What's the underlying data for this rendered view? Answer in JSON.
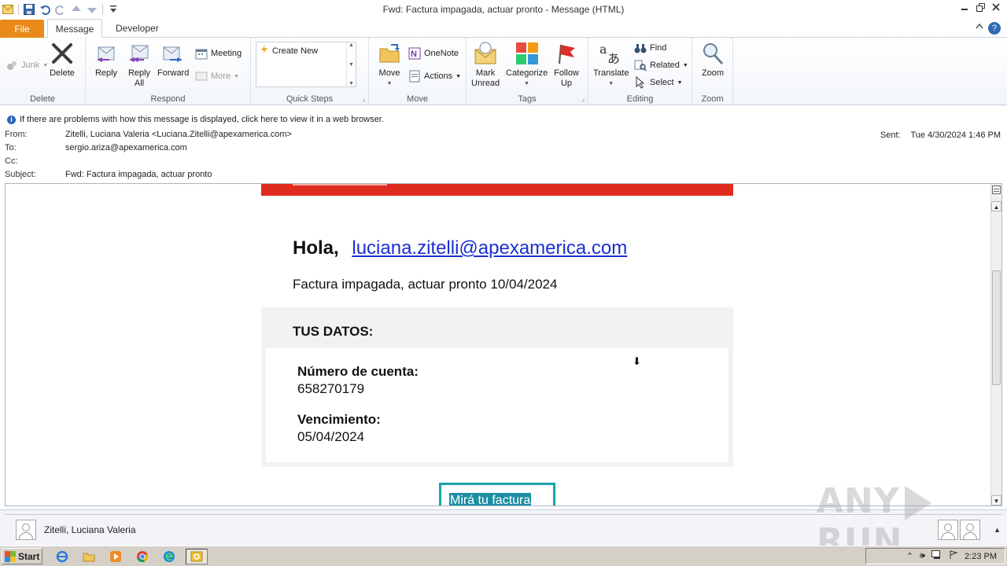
{
  "window": {
    "title": "Fwd: Factura impagada, actuar pronto  -  Message (HTML)"
  },
  "ribbon_tabs": {
    "file": "File",
    "message": "Message",
    "developer": "Developer"
  },
  "ribbon": {
    "delete_group": {
      "label": "Delete",
      "junk": "Junk",
      "delete": "Delete"
    },
    "respond_group": {
      "label": "Respond",
      "reply": "Reply",
      "reply_all_1": "Reply",
      "reply_all_2": "All",
      "forward": "Forward",
      "meeting": "Meeting",
      "more": "More"
    },
    "quick_steps_group": {
      "label": "Quick Steps",
      "create_new": "Create New"
    },
    "move_group": {
      "label": "Move",
      "move": "Move",
      "onenote": "OneNote",
      "actions": "Actions"
    },
    "tags_group": {
      "label": "Tags",
      "mark_unread_1": "Mark",
      "mark_unread_2": "Unread",
      "categorize": "Categorize",
      "follow_up_1": "Follow",
      "follow_up_2": "Up"
    },
    "editing_group": {
      "label": "Editing",
      "translate": "Translate",
      "find": "Find",
      "related": "Related",
      "select": "Select"
    },
    "zoom_group": {
      "label": "Zoom",
      "zoom": "Zoom"
    }
  },
  "infobar": {
    "text": "If there are problems with how this message is displayed, click here to view it in a web browser."
  },
  "header": {
    "from_label": "From:",
    "from_value": "Zitelli, Luciana Valeria <Luciana.Zitelli@apexamerica.com>",
    "to_label": "To:",
    "to_value": "sergio.ariza@apexamerica.com",
    "cc_label": "Cc:",
    "cc_value": "",
    "subject_label": "Subject:",
    "subject_value": "Fwd: Factura impagada, actuar pronto",
    "sent_label": "Sent:",
    "sent_value": "Tue 4/30/2024 1:46 PM"
  },
  "email_body": {
    "greeting": "Hola,",
    "greeting_email": "luciana.zitelli@apexamerica.com",
    "subtitle": "Factura impagada, actuar pronto 10/04/2024",
    "data_heading": "TUS DATOS:",
    "account_label": "Número de cuenta:",
    "account_value": "658270179",
    "due_label": "Vencimiento:",
    "due_value": "05/04/2024",
    "cta_label": "Mirá tu factura"
  },
  "people_pane": {
    "name": "Zitelli, Luciana Valeria"
  },
  "watermark": {
    "left": "ANY",
    "right": "RUN"
  },
  "taskbar": {
    "start": "Start",
    "clock": "2:23 PM"
  },
  "colors": {
    "red_banner": "#e02b1f",
    "link": "#1a2fd0",
    "cta_border": "#19a3ab",
    "file_tab": "#e8891a"
  }
}
